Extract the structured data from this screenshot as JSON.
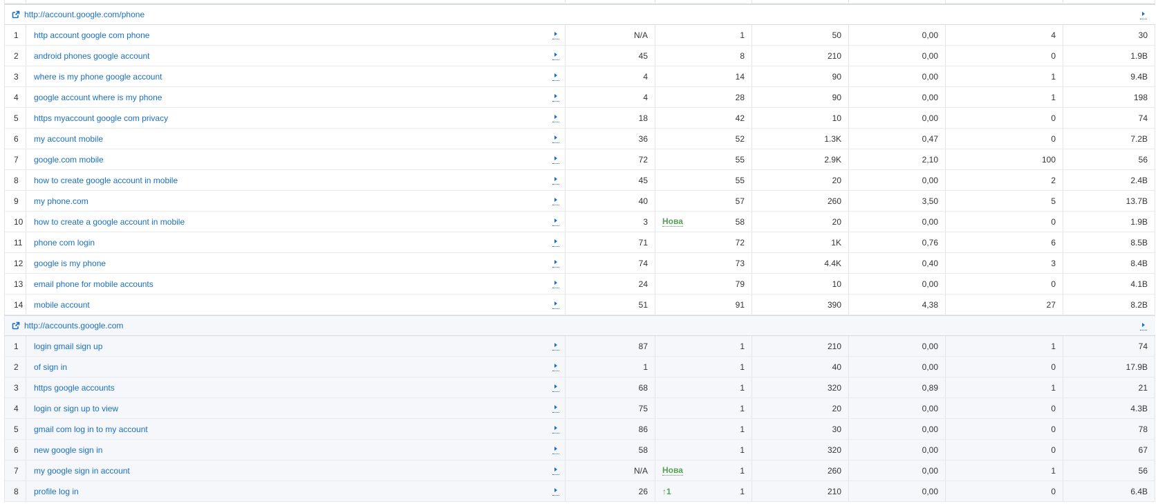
{
  "groups": [
    {
      "url": "http://account.google.com/phone",
      "rows": [
        {
          "n": "1",
          "kw": "http account google com phone",
          "pos": "N/A",
          "badge": "",
          "rank": "1",
          "vol": "50",
          "cpc": "0,00",
          "com": "4",
          "res": "30"
        },
        {
          "n": "2",
          "kw": "android phones google account",
          "pos": "45",
          "badge": "",
          "rank": "8",
          "vol": "210",
          "cpc": "0,00",
          "com": "0",
          "res": "1.9B"
        },
        {
          "n": "3",
          "kw": "where is my phone google account",
          "pos": "4",
          "badge": "",
          "rank": "14",
          "vol": "90",
          "cpc": "0,00",
          "com": "1",
          "res": "9.4B"
        },
        {
          "n": "4",
          "kw": "google account where is my phone",
          "pos": "4",
          "badge": "",
          "rank": "28",
          "vol": "90",
          "cpc": "0,00",
          "com": "1",
          "res": "198"
        },
        {
          "n": "5",
          "kw": "https myaccount google com privacy",
          "pos": "18",
          "badge": "",
          "rank": "42",
          "vol": "10",
          "cpc": "0,00",
          "com": "0",
          "res": "74"
        },
        {
          "n": "6",
          "kw": "my account mobile",
          "pos": "36",
          "badge": "",
          "rank": "52",
          "vol": "1.3K",
          "cpc": "0,47",
          "com": "0",
          "res": "7.2B"
        },
        {
          "n": "7",
          "kw": "google.com mobile",
          "pos": "72",
          "badge": "",
          "rank": "55",
          "vol": "2.9K",
          "cpc": "2,10",
          "com": "100",
          "res": "56"
        },
        {
          "n": "8",
          "kw": "how to create google account in mobile",
          "pos": "45",
          "badge": "",
          "rank": "55",
          "vol": "20",
          "cpc": "0,00",
          "com": "2",
          "res": "2.4B"
        },
        {
          "n": "9",
          "kw": "my phone.com",
          "pos": "40",
          "badge": "",
          "rank": "57",
          "vol": "260",
          "cpc": "3,50",
          "com": "5",
          "res": "13.7B"
        },
        {
          "n": "10",
          "kw": "how to create a google account in mobile",
          "pos": "3",
          "badge": "Нова",
          "rank": "58",
          "vol": "20",
          "cpc": "0,00",
          "com": "0",
          "res": "1.9B"
        },
        {
          "n": "11",
          "kw": "phone com login",
          "pos": "71",
          "badge": "",
          "rank": "72",
          "vol": "1K",
          "cpc": "0,76",
          "com": "6",
          "res": "8.5B"
        },
        {
          "n": "12",
          "kw": "google is my phone",
          "pos": "74",
          "badge": "",
          "rank": "73",
          "vol": "4.4K",
          "cpc": "0,40",
          "com": "3",
          "res": "8.4B"
        },
        {
          "n": "13",
          "kw": "email phone for mobile accounts",
          "pos": "24",
          "badge": "",
          "rank": "79",
          "vol": "10",
          "cpc": "0,00",
          "com": "0",
          "res": "4.1B"
        },
        {
          "n": "14",
          "kw": "mobile account",
          "pos": "51",
          "badge": "",
          "rank": "91",
          "vol": "390",
          "cpc": "4,38",
          "com": "27",
          "res": "8.2B"
        }
      ]
    },
    {
      "url": "http://accounts.google.com",
      "rows": [
        {
          "n": "1",
          "kw": "login gmail sign up",
          "pos": "87",
          "badge": "",
          "rank": "1",
          "vol": "210",
          "cpc": "0,00",
          "com": "1",
          "res": "74"
        },
        {
          "n": "2",
          "kw": "of sign in",
          "pos": "1",
          "badge": "",
          "rank": "1",
          "vol": "40",
          "cpc": "0,00",
          "com": "0",
          "res": "17.9B"
        },
        {
          "n": "3",
          "kw": "https google accounts",
          "pos": "68",
          "badge": "",
          "rank": "1",
          "vol": "320",
          "cpc": "0,89",
          "com": "1",
          "res": "21"
        },
        {
          "n": "4",
          "kw": "login or sign up to view",
          "pos": "75",
          "badge": "",
          "rank": "1",
          "vol": "20",
          "cpc": "0,00",
          "com": "0",
          "res": "4.3B"
        },
        {
          "n": "5",
          "kw": "gmail com log in to my account",
          "pos": "86",
          "badge": "",
          "rank": "1",
          "vol": "30",
          "cpc": "0,00",
          "com": "0",
          "res": "78"
        },
        {
          "n": "6",
          "kw": "new google sign in",
          "pos": "58",
          "badge": "",
          "rank": "1",
          "vol": "320",
          "cpc": "0,00",
          "com": "0",
          "res": "67"
        },
        {
          "n": "7",
          "kw": "my google sign in account",
          "pos": "N/A",
          "badge": "Нова",
          "rank": "1",
          "vol": "260",
          "cpc": "0,00",
          "com": "1",
          "res": "56"
        },
        {
          "n": "8",
          "kw": "profile log in",
          "pos": "26",
          "badge": "↑1",
          "rank": "1",
          "vol": "210",
          "cpc": "0,00",
          "com": "0",
          "res": "6.4B"
        }
      ]
    }
  ]
}
